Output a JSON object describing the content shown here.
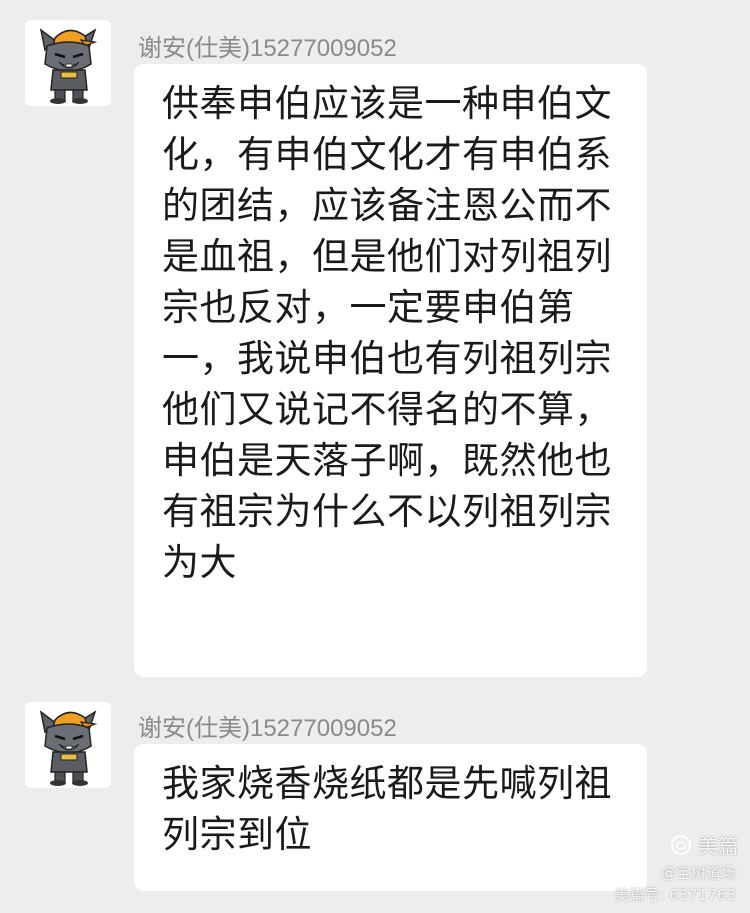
{
  "messages": [
    {
      "sender": "谢安(仕美)15277009052",
      "avatar": "grey-wolf-avatar",
      "text": "供奉申伯应该是一种申伯文化，有申伯文化才有申伯系的团结，应该备注恩公而不是血祖，但是他们对列祖列宗也反对，一定要申伯第一，我说申伯也有列祖列宗他们又说记不得名的不算，申伯是天落子啊，既然他也有祖宗为什么不以列祖列宗为大"
    },
    {
      "sender": "谢安(仕美)15277009052",
      "avatar": "grey-wolf-avatar",
      "text": "我家烧香烧纸都是先喊列祖列宗到位"
    }
  ],
  "watermark": {
    "brand": "美篇",
    "account": "@宝树道场",
    "meipian_id": "美篇号: 6371763"
  },
  "colors": {
    "background": "#ededed",
    "bubble": "#ffffff",
    "sender_text": "#8a8a8a",
    "message_text": "#1a1a1a"
  }
}
